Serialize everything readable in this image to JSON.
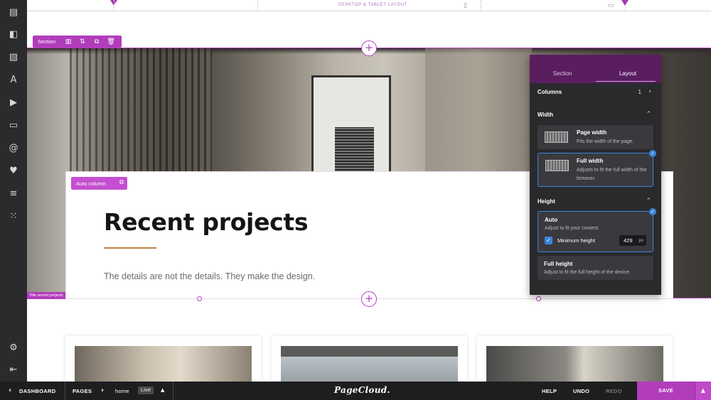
{
  "topbar": {
    "layout_label": "DESKTOP & TABLET LAYOUT"
  },
  "section_toolbar": {
    "label": "Section"
  },
  "column": {
    "label": "Auto column"
  },
  "content": {
    "title": "Recent projects",
    "subtitle": "The details are not the details. They make the design.",
    "section_tag": "Title recent projects"
  },
  "panel": {
    "tabs": [
      {
        "label": "Section",
        "active": false
      },
      {
        "label": "Layout",
        "active": true
      }
    ],
    "columns_label": "Columns",
    "columns_value": "1",
    "width_label": "Width",
    "width_options": [
      {
        "title": "Page width",
        "description": "Fits the width of the page.",
        "selected": false
      },
      {
        "title": "Full width",
        "description": "Adjusts to fit the full width of the browser.",
        "selected": true
      }
    ],
    "height_label": "Height",
    "height_options": [
      {
        "title": "Auto",
        "description": "Adjust to fit your content.",
        "selected": true
      },
      {
        "title": "Full height",
        "description": "Adjust to fit the full height of the device.",
        "selected": false
      }
    ],
    "min_height": {
      "label": "Minimum height",
      "checked": true,
      "value": "429",
      "unit": "px"
    }
  },
  "bottombar": {
    "dashboard": "DASHBOARD",
    "pages": "PAGES",
    "page_name": "home",
    "status": "Live",
    "logo": "PageCloud.",
    "help": "HELP",
    "undo": "UNDO",
    "redo": "REDO",
    "save": "SAVE"
  },
  "colors": {
    "accent": "#b13dbb",
    "selection": "#3a86d9",
    "panel_bg": "#2a2a2d",
    "panel_header": "#5a1d60"
  },
  "icons": {
    "sidebar": [
      "layout-icon",
      "shapes-icon",
      "image-icon",
      "text-icon",
      "video-icon",
      "button-icon",
      "at-icon",
      "heart-icon",
      "menu-icon",
      "apps-grid-icon",
      "settings-icon",
      "collapse-icon"
    ]
  }
}
